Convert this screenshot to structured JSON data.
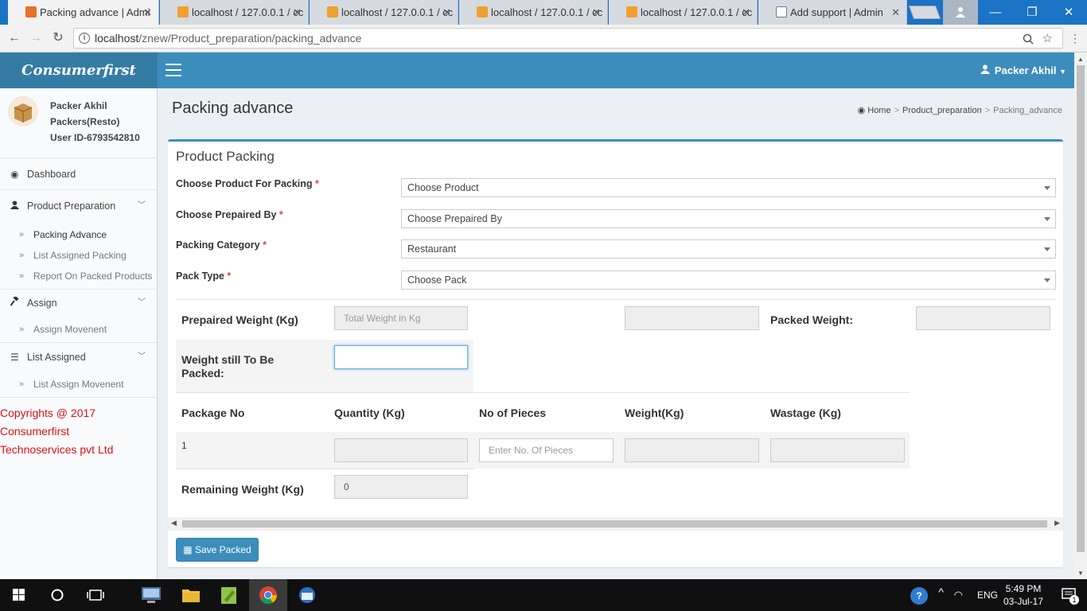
{
  "browser": {
    "tabs": [
      {
        "label": "Packing advance | Admi",
        "active": true
      },
      {
        "label": "localhost / 127.0.0.1 / cc",
        "active": false
      },
      {
        "label": "localhost / 127.0.0.1 / cc",
        "active": false
      },
      {
        "label": "localhost / 127.0.0.1 / cc",
        "active": false
      },
      {
        "label": "localhost / 127.0.0.1 / cc",
        "active": false
      },
      {
        "label": "Add support | Admin",
        "active": false
      }
    ],
    "url_host": "localhost",
    "url_path": "/znew/Product_preparation/packing_advance"
  },
  "header": {
    "logo": "Consumerfirst",
    "user": "Packer Akhil"
  },
  "sidebar": {
    "user_name": "Packer Akhil",
    "user_role": "Packers(Resto)",
    "user_id": "User ID-6793542810",
    "menu": {
      "dashboard": "Dashboard",
      "product_preparation": "Product Preparation",
      "packing_advance": "Packing Advance",
      "list_assigned_packing": "List Assigned Packing",
      "report_on_packed": "Report On Packed Products",
      "assign": "Assign",
      "assign_movement": "Assign Movenent",
      "list_assigned": "List Assigned",
      "list_assign_movement": "List Assign Movenent"
    },
    "copyright": [
      "Copyrights @ 2017",
      "Consumerfirst",
      "Technoservices pvt Ltd"
    ]
  },
  "page": {
    "title": "Packing advance",
    "breadcrumb": {
      "home": "Home",
      "section": "Product_preparation",
      "current": "Packing_advance"
    }
  },
  "form": {
    "box_title": "Product Packing",
    "product_label": "Choose Product For Packing",
    "product_value": "Choose Product",
    "prepaired_by_label": "Choose Prepaired By",
    "prepaired_by_value": "Choose Prepaired By",
    "category_label": "Packing Category",
    "category_value": "Restaurant",
    "pack_type_label": "Pack Type",
    "pack_type_value": "Choose Pack",
    "required_mark": "*",
    "prepaired_weight_label": "Prepaired Weight (Kg)",
    "prepaired_weight_placeholder": "Total Weight in Kg",
    "packed_weight_label": "Packed Weight:",
    "weight_still_label_1": "Weight still To Be",
    "weight_still_label_2": "Packed:",
    "table_headers": [
      "Package No",
      "Quantity (Kg)",
      "No of Pieces",
      "Weight(Kg)",
      "Wastage (Kg)"
    ],
    "row_package_no": "1",
    "pieces_placeholder": "Enter No. Of Pieces",
    "remaining_label": "Remaining Weight (Kg)",
    "remaining_value": "0",
    "save_button": "Save Packed"
  },
  "taskbar": {
    "time": "5:49 PM",
    "date": "03-Jul-17",
    "lang": "ENG",
    "notifications": "1"
  }
}
